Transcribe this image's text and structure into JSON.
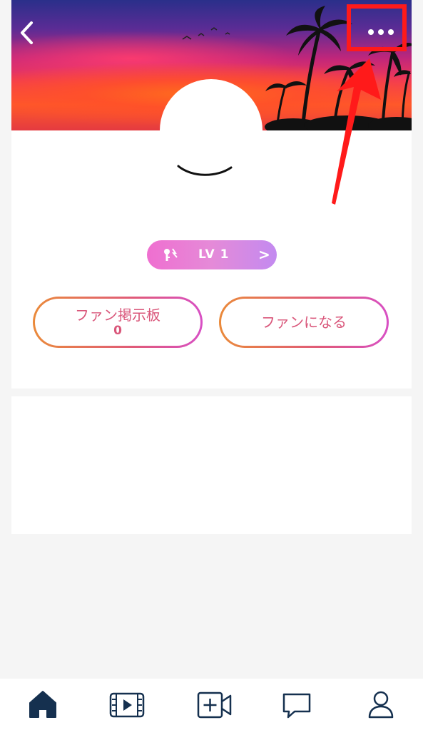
{
  "header": {
    "back_icon": "chevron-left-icon",
    "more_icon": "more-horizontal-icon"
  },
  "profile": {
    "level_label": "LV 1",
    "level_chevron": ">"
  },
  "actions": {
    "fan_board_label": "ファン掲示板",
    "fan_board_count": "0",
    "become_fan_label": "ファンになる"
  },
  "annotation": {
    "highlight_color": "#ff1a1a"
  },
  "bottom_nav": {
    "items": [
      {
        "icon": "home-icon"
      },
      {
        "icon": "video-play-icon"
      },
      {
        "icon": "add-video-icon"
      },
      {
        "icon": "chat-bubble-icon"
      },
      {
        "icon": "user-icon"
      }
    ]
  }
}
